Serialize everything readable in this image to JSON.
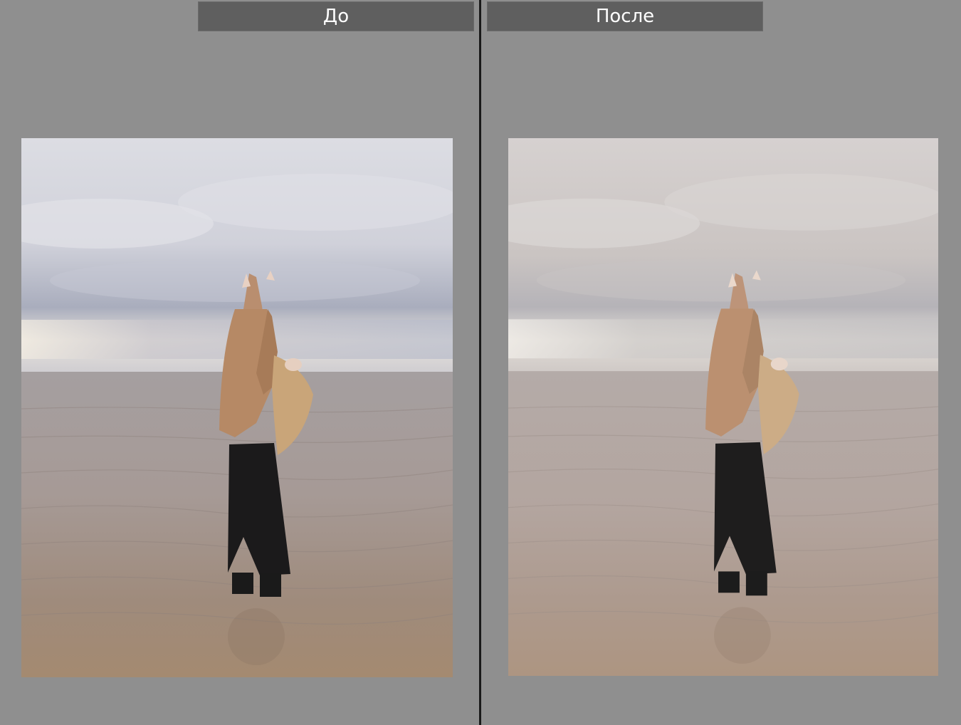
{
  "compare": {
    "before_label": "До",
    "after_label": "После"
  },
  "colors": {
    "background": "#8f8f8f",
    "label_bar": "#5f5f5f",
    "divider": "#1a1a1a"
  }
}
